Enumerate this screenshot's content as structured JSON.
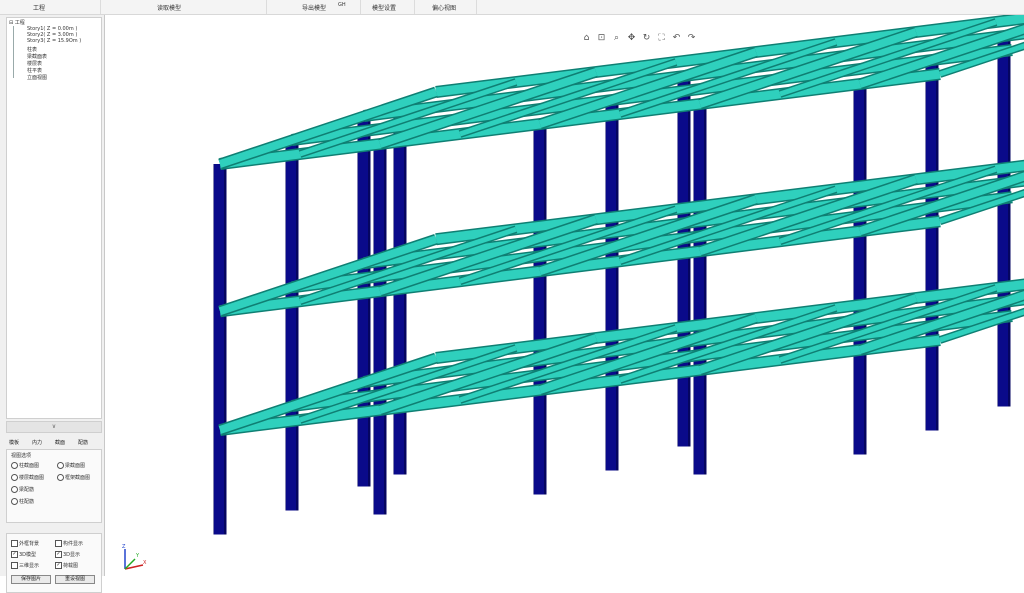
{
  "menubar": {
    "items": [
      "工程",
      "读取模型",
      "导出模型",
      "GH",
      "模型设置",
      "偏心视图"
    ]
  },
  "tree": {
    "root": "工程",
    "items": [
      "Story1( Z = 0.00m )",
      "Story2( Z = 3.00m )",
      "Story3( Z = 15.9Om )",
      "柱表",
      "梁截面表",
      "楼层表",
      "柱平表",
      "立面视图"
    ]
  },
  "collapse_label": "∨",
  "tabs": [
    "模板",
    "内力",
    "截面",
    "配筋"
  ],
  "panel": {
    "title": "视图选项",
    "options": [
      "柱截面图",
      "梁截面图",
      "楼层截面图",
      "框架截面图",
      "梁配筋",
      "柱配筋"
    ]
  },
  "checks": {
    "items": [
      {
        "label": "外框背景",
        "checked": false
      },
      {
        "label": "构件显示",
        "checked": false
      },
      {
        "label": "3D模型",
        "checked": true
      },
      {
        "label": "3D显示",
        "checked": true
      },
      {
        "label": "三维显示",
        "checked": false
      },
      {
        "label": "荷载图",
        "checked": true
      }
    ],
    "buttons": [
      "保存图片",
      "重设视图"
    ]
  },
  "toolbar": {
    "icons": [
      "home-icon",
      "zoom-window-icon",
      "zoom-icon",
      "pan-icon",
      "rotate-icon",
      "fit-icon",
      "undo-icon",
      "redo-icon"
    ]
  },
  "axes": {
    "x": "X",
    "y": "Y",
    "z": "Z"
  },
  "colors": {
    "beam": "#2fd0bd",
    "column": "#0a0a8a"
  }
}
